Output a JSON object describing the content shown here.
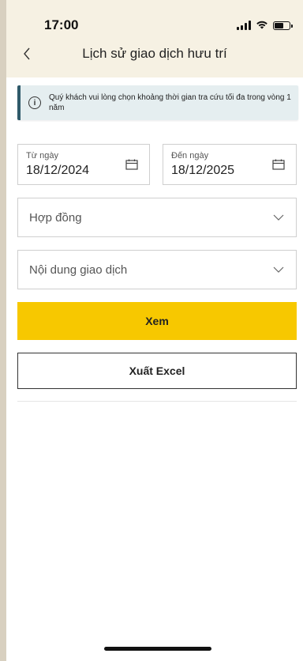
{
  "status_bar": {
    "time": "17:00"
  },
  "nav": {
    "title": "Lịch sử giao dịch hưu trí",
    "back_icon": "chevron-left-icon"
  },
  "info": {
    "message": "Quý khách vui lòng chọn khoảng thời gian tra cứu tối đa trong vòng 1 năm",
    "icon": "info-icon"
  },
  "date_from": {
    "label": "Từ ngày",
    "value": "18/12/2024",
    "icon": "calendar-icon"
  },
  "date_to": {
    "label": "Đến ngày",
    "value": "18/12/2025",
    "icon": "calendar-icon"
  },
  "contract_select": {
    "value": "Hợp đồng",
    "icon": "chevron-down-icon"
  },
  "transaction_select": {
    "value": "Nội dung giao dịch",
    "icon": "chevron-down-icon"
  },
  "buttons": {
    "view": "Xem",
    "export": "Xuất Excel"
  },
  "colors": {
    "accent": "#f7c800",
    "header_bg": "#f6f1e3",
    "info_bg": "#e5eef0",
    "info_border": "#2f5a6a"
  }
}
